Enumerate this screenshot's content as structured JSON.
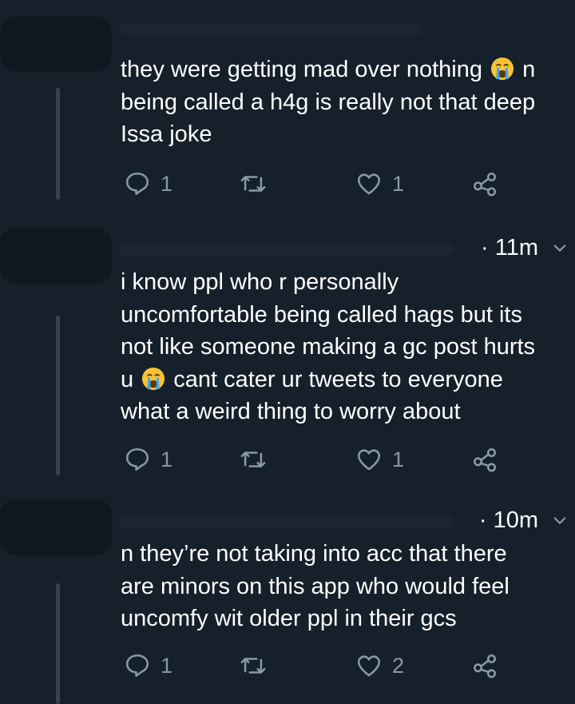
{
  "colors": {
    "background": "#15202b",
    "text": "#ffffff",
    "icon_gray": "#8899a6",
    "thread_line": "#38444d"
  },
  "tweets": [
    {
      "timestamp": "",
      "text_before_emoji": "they were getting mad over nothing ",
      "emoji": "loudly-crying-face",
      "text_after_emoji": " n\nbeing called a h4g is really not that deep\nIssa joke",
      "reply_count": "1",
      "retweet_count": "",
      "like_count": "1"
    },
    {
      "timestamp": "· 11m",
      "text_before_emoji": "i know ppl who r personally\nuncomfortable being called hags but its\nnot like someone making a gc post hurts\nu ",
      "emoji": "loudly-crying-face",
      "text_after_emoji": " cant cater ur tweets to everyone\nwhat a weird thing to worry about",
      "reply_count": "1",
      "retweet_count": "",
      "like_count": "1"
    },
    {
      "timestamp": "· 10m",
      "text_before_emoji": "n they’re not taking into acc that there\nare minors on this app who would feel\nuncomfy wit older ppl in their gcs",
      "emoji": "",
      "text_after_emoji": "",
      "reply_count": "1",
      "retweet_count": "",
      "like_count": "2"
    }
  ]
}
